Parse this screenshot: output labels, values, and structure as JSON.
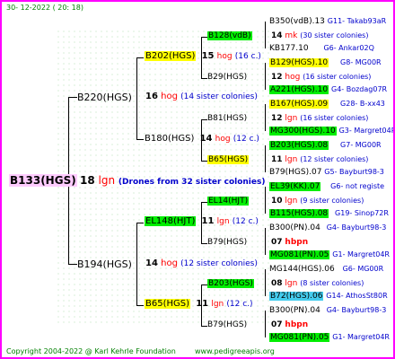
{
  "header": {
    "date": "30- 12-2022 ( 20: 18)"
  },
  "footer": {
    "copyright": "Copyright 2004-2022 @ Karl Kehrle Foundation",
    "website": "www.pedigreeapis.org"
  },
  "colors": {
    "frame": "#ff00ff",
    "queen_highlight": "#ffccff",
    "mating_station": "#ffff00",
    "breeder_queen": "#00ee00",
    "selected_line": "#44ccee",
    "drone_text": "#ff0000",
    "colony_text": "#0000cc"
  },
  "root": {
    "queen": "B133(HGS)",
    "num": "18",
    "lgn": "lgn",
    "drones": "(Drones from 32 sister colonies)"
  },
  "gen1": [
    {
      "queen": "B220(HGS)",
      "num": "16",
      "hog": "hog",
      "colonies": "(14 sister colonies)"
    },
    {
      "queen": "B194(HGS)",
      "num": "14",
      "hog": "hog",
      "colonies": "(12 sister colonies)"
    }
  ],
  "gen2": [
    {
      "queen": "B202(HGS)",
      "num": "15",
      "ds": "hog",
      "colonies": "(16 c.)"
    },
    {
      "queen": "B180(HGS)",
      "num": "14",
      "ds": "hog",
      "colonies": "(12 c.)"
    },
    {
      "queen": "EL148(HJT)",
      "num": "11",
      "ds": "lgn",
      "colonies": "(12 c.)"
    },
    {
      "queen": "B65(HGS)",
      "num": "11",
      "ds": "lgn",
      "colonies": "(12 c.)"
    }
  ],
  "gen3": [
    {
      "queen": "B128(vdB)",
      "num": "14",
      "ds": "mk",
      "colonies": "(30 sister colonies)"
    },
    {
      "queen": "B29(HGS)",
      "num": "12",
      "ds": "hog",
      "colonies": "(16 sister colonies)"
    },
    {
      "queen": "B81(HGS)",
      "num": "12",
      "ds": "lgn",
      "colonies": "(16 sister colonies)"
    },
    {
      "queen": "B65(HGS)",
      "num": "11",
      "ds": "lgn",
      "colonies": "(12 sister colonies)"
    },
    {
      "queen": "EL14(HJT)",
      "num": "10",
      "ds": "lgn",
      "colonies": "(9 sister colonies)"
    },
    {
      "queen": "B79(HGS)",
      "num": "07",
      "ds": "hbpn",
      "colonies": ""
    },
    {
      "queen": "B203(HGS)",
      "num": "08",
      "ds": "lgn",
      "colonies": "(8 sister colonies)"
    },
    {
      "queen": "B79(HGS)",
      "num": "07",
      "ds": "hbpn",
      "colonies": ""
    }
  ],
  "gen4": [
    {
      "queen": "B350(vdB).13",
      "code": "G11",
      "colony": "- Takab93aR"
    },
    {
      "queen": "KB177.10",
      "code": "G6",
      "colony": "- Ankar02Q"
    },
    {
      "queen": "B129(HGS).10",
      "code": "G8",
      "colony": "- MG00R"
    },
    {
      "queen": "A221(HGS).10",
      "code": "G4",
      "colony": "- Bozdag07R"
    },
    {
      "queen": "B167(HGS).09",
      "code": "G28",
      "colony": "- B-xx43"
    },
    {
      "queen": "MG300(HGS).10",
      "code": "G3",
      "colony": "- Margret04R"
    },
    {
      "queen": "B203(HGS).08",
      "code": "G7",
      "colony": "- MG00R"
    },
    {
      "queen": "B79(HGS).07",
      "code": "G5",
      "colony": "- Bayburt98-3"
    },
    {
      "queen": "EL39(KK).07",
      "code": "G6",
      "colony": "- not registe"
    },
    {
      "queen": "B115(HGS).08",
      "code": "G19",
      "colony": "- Sinop72R"
    },
    {
      "queen": "B300(PN).04",
      "code": "G4",
      "colony": "- Bayburt98-3"
    },
    {
      "queen": "MG081(PN).05",
      "code": "G1",
      "colony": "- Margret04R"
    },
    {
      "queen": "MG144(HGS).06",
      "code": "G6",
      "colony": "- MG00R"
    },
    {
      "queen": "B72(HGS).06",
      "code": "G14",
      "colony": "- AthosSt80R"
    },
    {
      "queen": "B300(PN).04",
      "code": "G4",
      "colony": "- Bayburt98-3"
    },
    {
      "queen": "MG081(PN).05",
      "code": "G1",
      "colony": "- Margret04R"
    }
  ]
}
